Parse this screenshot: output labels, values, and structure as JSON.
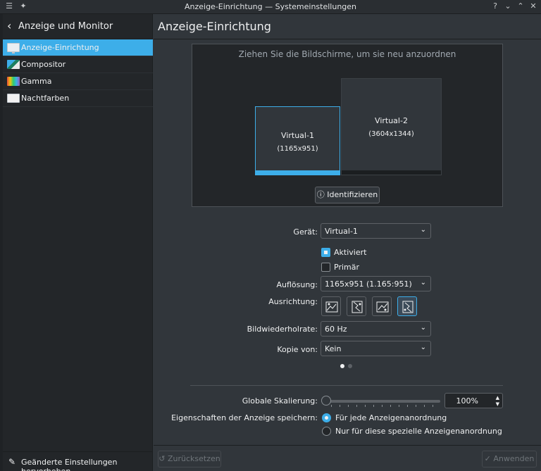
{
  "window": {
    "title": "Anzeige-Einrichtung — Systemeinstellungen",
    "icons": [
      "menu-icon",
      "pin-icon",
      "help-icon",
      "minimize-icon",
      "maximize-icon",
      "close-icon"
    ]
  },
  "sidebar": {
    "back_label": "Anzeige und Monitor",
    "items": [
      {
        "label": "Anzeige-Einrichtung",
        "icon": "monitor-icon",
        "active": true
      },
      {
        "label": "Compositor",
        "icon": "compositor-icon",
        "active": false
      },
      {
        "label": "Gamma",
        "icon": "gamma-icon",
        "active": false
      },
      {
        "label": "Nachtfarben",
        "icon": "night-color-icon",
        "active": false
      }
    ],
    "footer_label": "Geänderte Einstellungen hervorheben"
  },
  "main": {
    "title": "Anzeige-Einrichtung",
    "arrange_hint": "Ziehen Sie die Bildschirme, um sie neu anzuordnen",
    "screens": [
      {
        "name": "Virtual-1",
        "resolution": "(1165x951)",
        "selected": true
      },
      {
        "name": "Virtual-2",
        "resolution": "(3604x1344)",
        "selected": false
      }
    ],
    "identify_label": "Identifizieren"
  },
  "form": {
    "device_label": "Gerät:",
    "device_value": "Virtual-1",
    "enabled_label": "Aktiviert",
    "enabled": true,
    "primary_label": "Primär",
    "primary": false,
    "resolution_label": "Auflösung:",
    "resolution_value": "1165x951 (1.165:951)",
    "orientation_label": "Ausrichtung:",
    "orientation_selected": 3,
    "refresh_label": "Bildwiederholrate:",
    "refresh_value": "60 Hz",
    "copy_label": "Kopie von:",
    "copy_value": "Kein",
    "pager_active": 0
  },
  "global": {
    "scale_label": "Globale Skalierung:",
    "scale_value": "100%",
    "save_label": "Eigenschaften der Anzeige speichern:",
    "save_option_all": "Für jede Anzeigenanordnung",
    "save_option_this": "Nur für diese spezielle Anzeigenanordnung",
    "save_selected": "all"
  },
  "buttons": {
    "reset_label": "Zurücksetzen",
    "apply_label": "Anwenden"
  },
  "colors": {
    "accent": "#3daee9",
    "window_bg": "#31363b",
    "view_bg": "#232629"
  }
}
